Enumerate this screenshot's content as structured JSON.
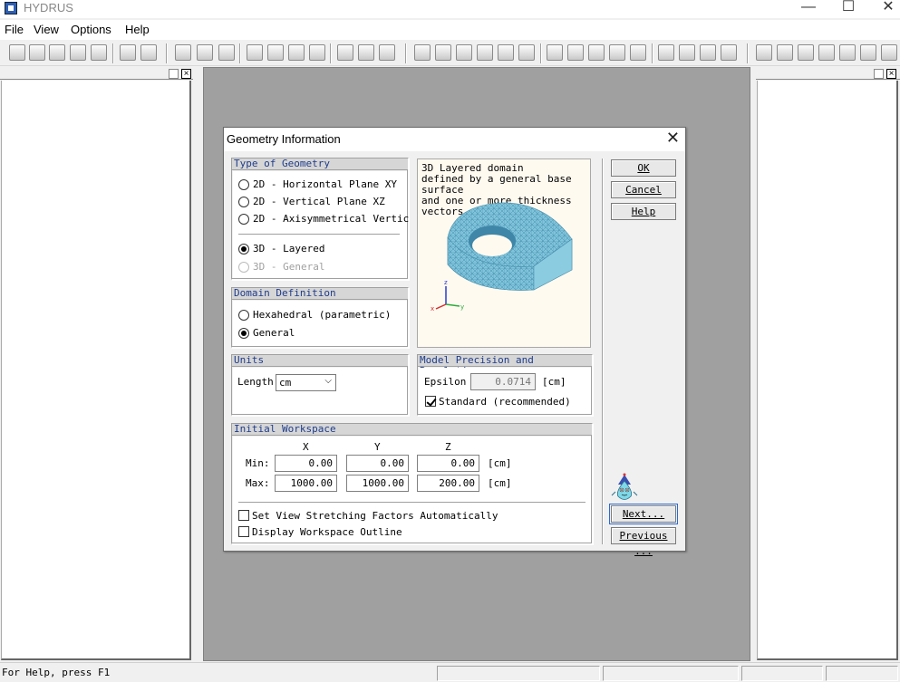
{
  "app": {
    "title": "HYDRUS",
    "window_controls": {
      "minimize": "—",
      "maximize": "☐",
      "close": "✕"
    }
  },
  "menu": [
    "File",
    "View",
    "Options",
    "Help"
  ],
  "status": {
    "help_text": "For Help, press F1"
  },
  "dialog": {
    "title": "Geometry Information",
    "close_glyph": "✕",
    "type_of_geometry": {
      "heading": "Type of Geometry",
      "options": [
        {
          "label": "2D - Horizontal Plane XY",
          "checked": false,
          "enabled": true
        },
        {
          "label": "2D - Vertical Plane XZ",
          "checked": false,
          "enabled": true
        },
        {
          "label": "2D - Axisymmetrical Vertic",
          "checked": false,
          "enabled": true
        },
        {
          "label": "3D - Layered",
          "checked": true,
          "enabled": true
        },
        {
          "label": "3D - General",
          "checked": false,
          "enabled": false
        }
      ]
    },
    "domain_definition": {
      "heading": "Domain Definition",
      "options": [
        {
          "label": "Hexahedral (parametric)",
          "checked": false
        },
        {
          "label": "General",
          "checked": true
        }
      ]
    },
    "preview": {
      "text": "3D Layered domain\ndefined by a general base\nsurface\nand one or more thickness\nvectors.",
      "axis_labels": {
        "z": "z",
        "x": "x",
        "y": "y"
      },
      "mesh_color": "#7fc4db"
    },
    "units": {
      "heading": "Units",
      "length_label": "Length",
      "length_value": "cm"
    },
    "precision": {
      "heading": "Model Precision and Resolution",
      "epsilon_label": "Epsilon",
      "epsilon_value": "0.0714",
      "epsilon_unit": "[cm]",
      "standard_label": "Standard (recommended)",
      "standard_checked": true
    },
    "workspace": {
      "heading": "Initial Workspace",
      "col_x": "X",
      "col_y": "Y",
      "col_z": "Z",
      "min_label": "Min:",
      "max_label": "Max:",
      "min": {
        "x": "0.00",
        "y": "0.00",
        "z": "0.00"
      },
      "max": {
        "x": "1000.00",
        "y": "1000.00",
        "z": "200.00"
      },
      "unit": "[cm]",
      "stretch_label": "Set View Stretching Factors Automatically",
      "stretch_checked": false,
      "outline_label": "Display Workspace Outline",
      "outline_checked": false
    },
    "buttons": {
      "ok": "OK",
      "cancel": "Cancel",
      "help": "Help",
      "next": "Next...",
      "previous": "Previous ..."
    }
  }
}
